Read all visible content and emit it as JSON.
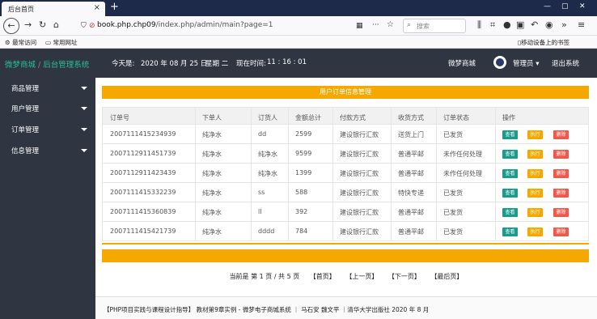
{
  "browser": {
    "tab_title": "后台首页",
    "url_prefix": "⊘",
    "url_host": "book.php.chp09",
    "url_path": "/index.php/admin/main?page=1",
    "search_placeholder": "搜索",
    "bookmarks": [
      "最常访问",
      "常用网址"
    ],
    "mobile_bookmarks": "移动设备上的书签"
  },
  "header": {
    "brand": "微梦商城",
    "brand_sub": "后台管理系统",
    "date_label": "今天是:",
    "date_value": "2020 年 08 月 25 日",
    "weekday": "星期 二",
    "time_label": "现在时间:",
    "time_value": "11 : 16 : 01",
    "shop_name": "微梦商城",
    "user_menu": "管理员 ▾",
    "logout": "退出系统"
  },
  "sidebar": {
    "items": [
      {
        "label": "商品管理"
      },
      {
        "label": "用户管理"
      },
      {
        "label": "订单管理"
      },
      {
        "label": "信息管理"
      }
    ]
  },
  "main": {
    "title": "用户订单信息管理",
    "columns": [
      "订单号",
      "下单人",
      "订货人",
      "金额总计",
      "付款方式",
      "收货方式",
      "订单状态",
      "操作"
    ],
    "rows": [
      {
        "id": "2007111415234939",
        "buyer": "纯净水",
        "receiver": "dd",
        "total": "2599",
        "payment": "建设银行汇款",
        "delivery": "送货上门",
        "status": "已发货"
      },
      {
        "id": "2007112911451739",
        "buyer": "纯净水",
        "receiver": "纯净水",
        "total": "9599",
        "payment": "建设银行汇款",
        "delivery": "普通平邮",
        "status": "未作任何处理"
      },
      {
        "id": "2007112911423439",
        "buyer": "纯净水",
        "receiver": "纯净水",
        "total": "1399",
        "payment": "建设银行汇款",
        "delivery": "普通平邮",
        "status": "未作任何处理"
      },
      {
        "id": "2007111415332239",
        "buyer": "纯净水",
        "receiver": "ss",
        "total": "588",
        "payment": "建设银行汇款",
        "delivery": "特快专递",
        "status": "已发货"
      },
      {
        "id": "2007111415360839",
        "buyer": "纯净水",
        "receiver": "ll",
        "total": "392",
        "payment": "建设银行汇款",
        "delivery": "普通平邮",
        "status": "已发货"
      },
      {
        "id": "2007111415421739",
        "buyer": "纯净水",
        "receiver": "dddd",
        "total": "784",
        "payment": "建设银行汇款",
        "delivery": "普通平邮",
        "status": "已发货"
      }
    ],
    "actions": {
      "view": "查看",
      "exec": "执行",
      "del": "删除"
    },
    "pager": {
      "info": "当前是 第 1 页 / 共 5 页",
      "first": "【首页】",
      "prev": "【上一页】",
      "next": "【下一页】",
      "last": "【最后页】"
    }
  },
  "footer": {
    "text": "【PHP项目实践与课程设计指导】 教材第9章实例 - 微梦电子商城系统 ｜ 马石安 魏文平 ｜清华大学出版社 2020 年 8 月"
  },
  "colors": {
    "accent_orange": "#f5a800",
    "brand_green": "#2bbf95",
    "header_dark": "#2f3541",
    "view_btn": "#1a9b8a",
    "del_btn": "#f0594a"
  }
}
